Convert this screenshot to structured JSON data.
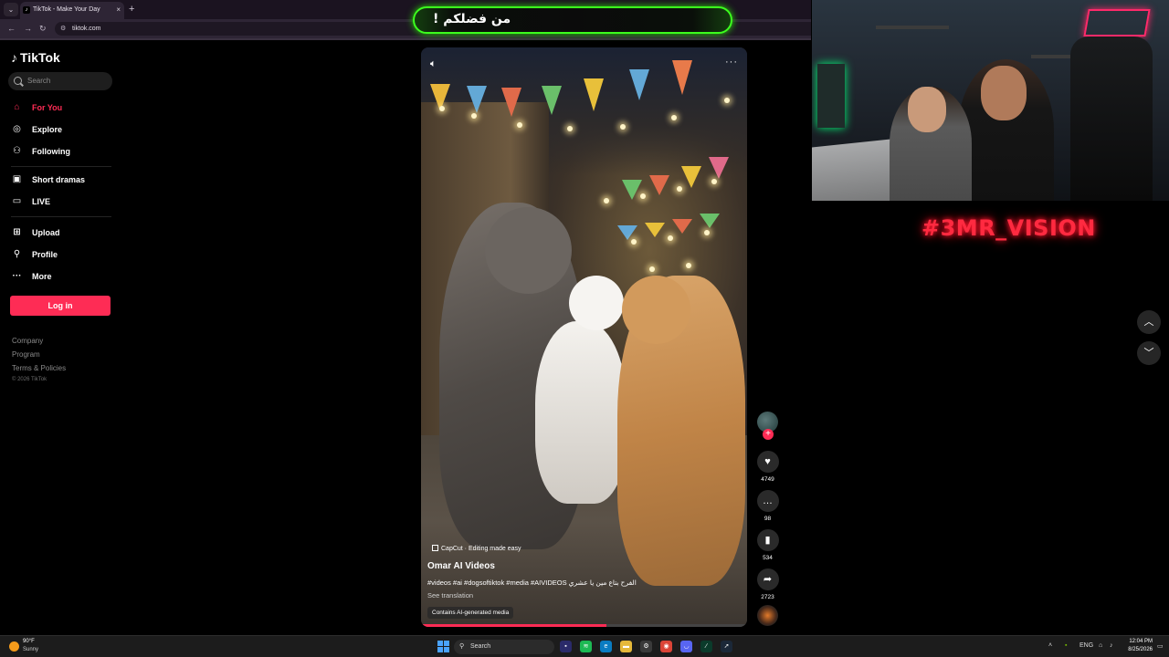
{
  "browser": {
    "tab_title": "TikTok - Make Your Day",
    "url": "tiktok.com",
    "new_tab": "+",
    "tab_close": "×"
  },
  "banner": {
    "text": "من فضلكم !"
  },
  "sidebar": {
    "logo": "TikTok",
    "search_placeholder": "Search",
    "nav": [
      {
        "label": "For You",
        "icon": "home-icon",
        "active": true
      },
      {
        "label": "Explore",
        "icon": "compass-icon"
      },
      {
        "label": "Following",
        "icon": "following-icon"
      },
      {
        "label": "Short dramas",
        "icon": "film-icon"
      },
      {
        "label": "LIVE",
        "icon": "live-icon"
      },
      {
        "label": "Upload",
        "icon": "upload-icon"
      },
      {
        "label": "Profile",
        "icon": "profile-icon"
      },
      {
        "label": "More",
        "icon": "more-icon"
      }
    ],
    "login_label": "Log in",
    "footer": [
      "Company",
      "Program",
      "Terms & Policies"
    ],
    "copyright": "© 2026 TikTok"
  },
  "video": {
    "capcut": "CapCut · Editing made easy",
    "author": "Omar AI Videos",
    "caption": "#videos #ai #dogsoftiktok #media #AIVIDEOS الفرح بتاع مين يا عشري",
    "translate": "See translation",
    "ai_label": "Contains AI-generated media",
    "progress": 0.57
  },
  "actions": {
    "likes": "4749",
    "comments": "98",
    "saves": "534",
    "shares": "2723"
  },
  "overlay": {
    "neon_text": "#3MR_VISION"
  },
  "taskbar": {
    "temp": "90°F",
    "weather": "Sunny",
    "search": "Search",
    "lang": "ENG",
    "time": "12:04 PM",
    "date": "8/25/2026"
  },
  "colors": {
    "accent": "#fe2c55",
    "banner_glow": "#3cff1e",
    "neon": "#ff2a40"
  }
}
